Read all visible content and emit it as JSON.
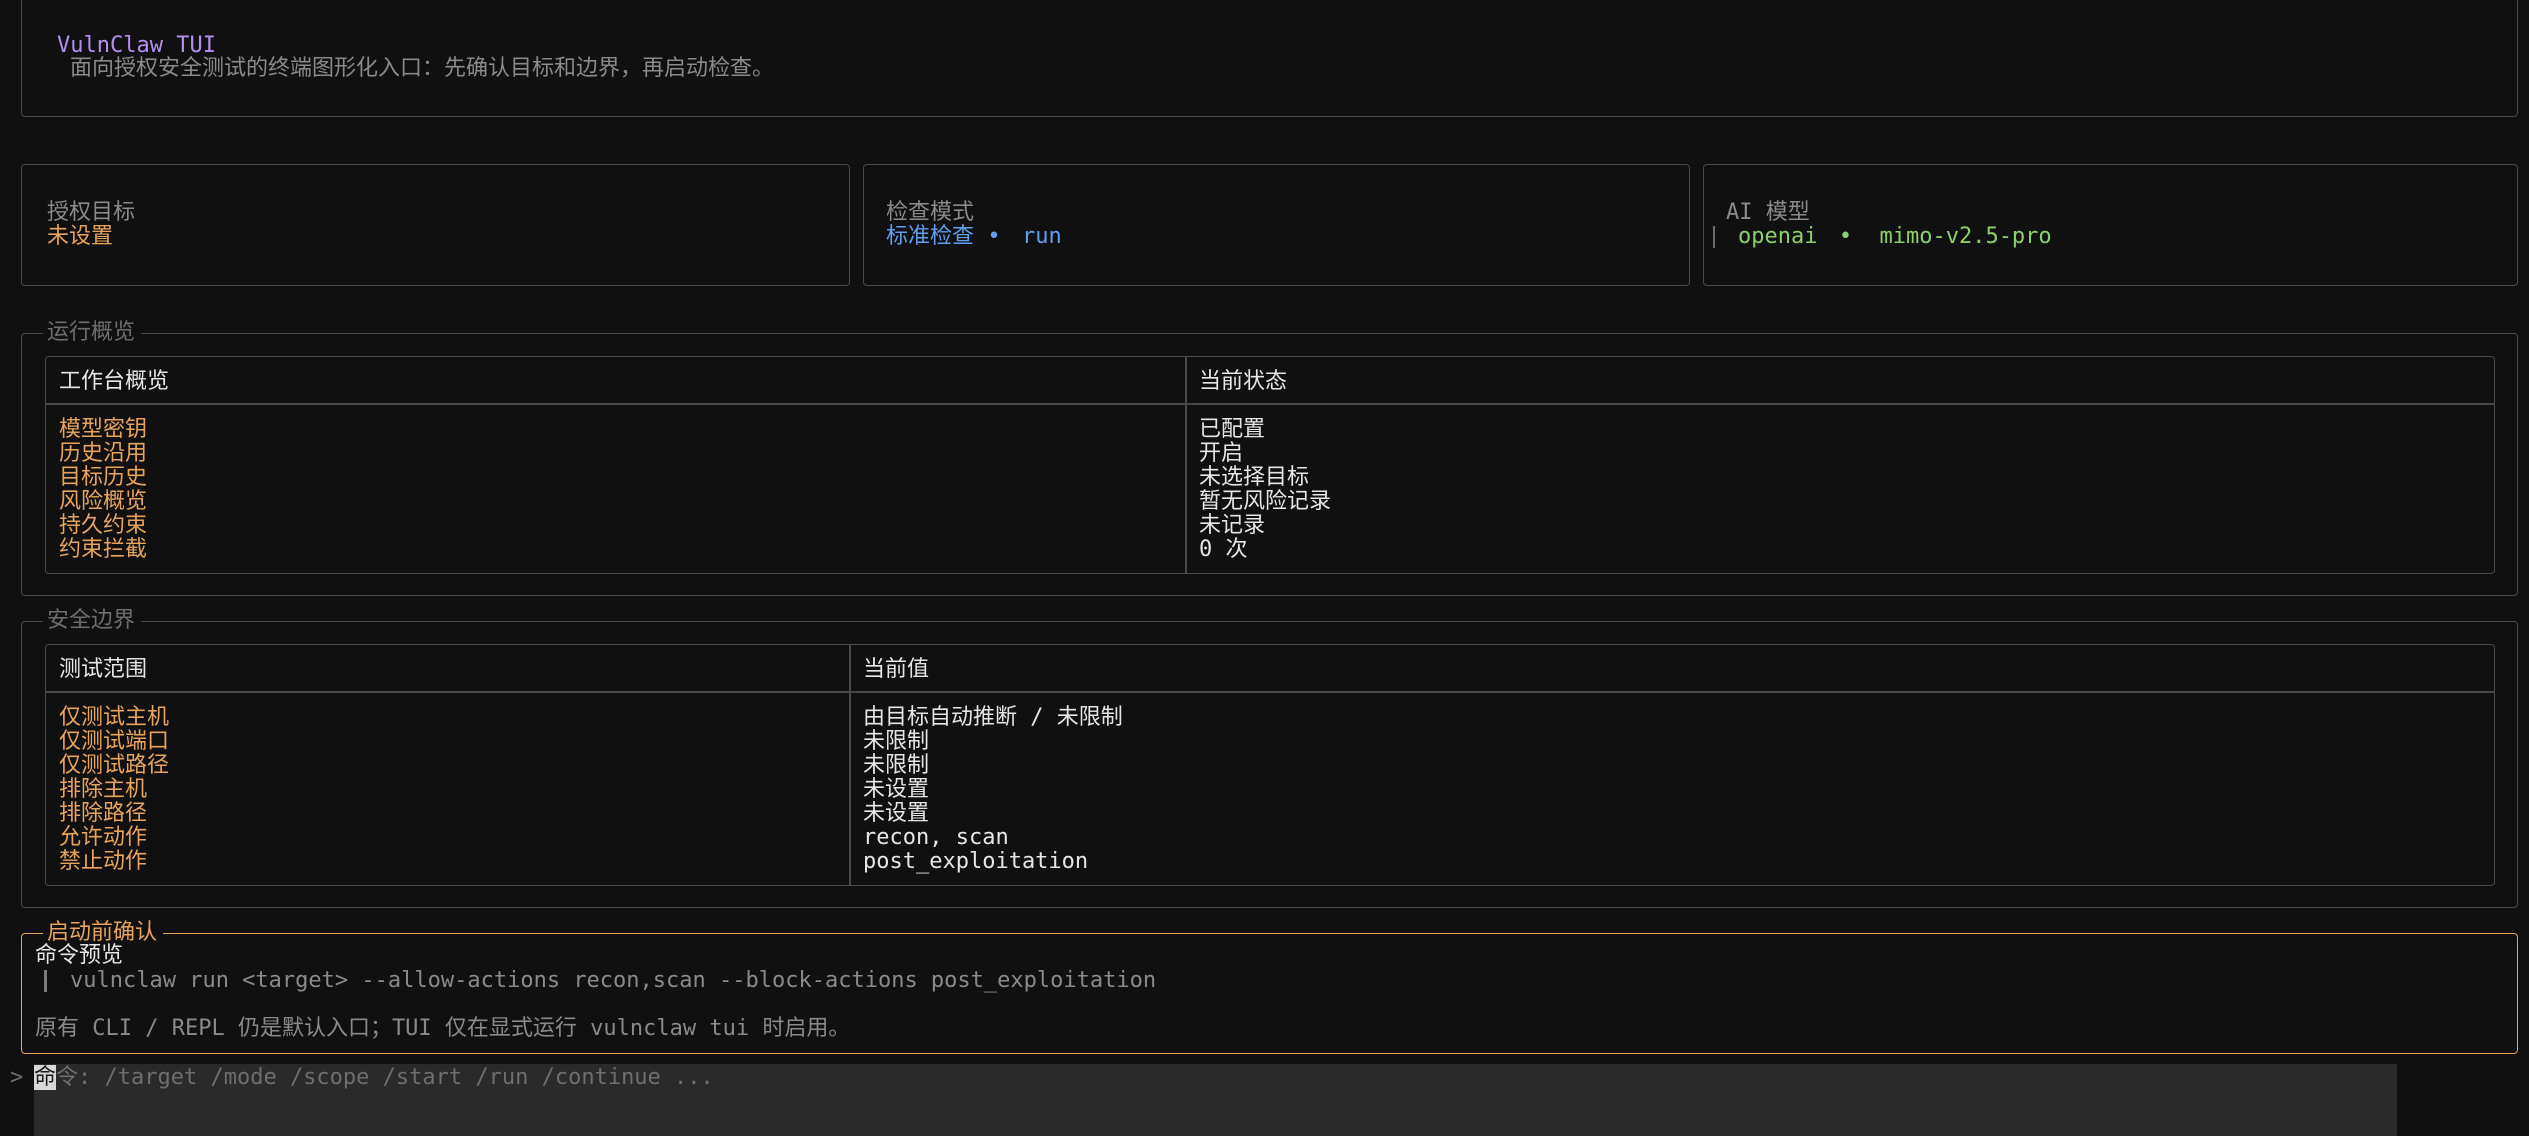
{
  "header": {
    "app_title": "VulnClaw TUI",
    "subtitle": "面向授权安全测试的终端图形化入口：先确认目标和边界，再启动检查。"
  },
  "cards": {
    "target": {
      "label": "授权目标",
      "value": "未设置"
    },
    "mode": {
      "label": "检查模式",
      "value": "标准检查",
      "sep": "•",
      "sub": "run"
    },
    "model": {
      "label": "AI 模型",
      "provider": "openai",
      "sep": "•",
      "name": "mimo-v2.5-pro"
    }
  },
  "overview": {
    "title": "运行概览",
    "col1": "工作台概览",
    "col2": "当前状态",
    "rows": [
      {
        "key": "模型密钥",
        "value": "已配置"
      },
      {
        "key": "历史沿用",
        "value": "开启"
      },
      {
        "key": "目标历史",
        "value": "未选择目标"
      },
      {
        "key": "风险概览",
        "value": "暂无风险记录"
      },
      {
        "key": "持久约束",
        "value": "未记录"
      },
      {
        "key": "约束拦截",
        "value": "0 次"
      }
    ]
  },
  "boundary": {
    "title": "安全边界",
    "col1": "测试范围",
    "col2": "当前值",
    "rows": [
      {
        "key": "仅测试主机",
        "value": "由目标自动推断 / 未限制"
      },
      {
        "key": "仅测试端口",
        "value": "未限制"
      },
      {
        "key": "仅测试路径",
        "value": "未限制"
      },
      {
        "key": "排除主机",
        "value": "未设置"
      },
      {
        "key": "排除路径",
        "value": "未设置"
      },
      {
        "key": "允许动作",
        "value": "recon, scan"
      },
      {
        "key": "禁止动作",
        "value": "post_exploitation"
      }
    ]
  },
  "confirm": {
    "title": "启动前确认",
    "preview_label": "命令预览",
    "command": "vulnclaw run <target> --allow-actions recon,scan --block-actions post_exploitation",
    "note": "原有 CLI / REPL 仍是默认入口；TUI 仅在显式运行 vulnclaw tui 时启用。"
  },
  "prompt": {
    "arrow": ">",
    "cursor_char": "命",
    "placeholder_rest": "令: /target /mode /scope /start /run /continue ..."
  },
  "colors": {
    "background": "#101010",
    "border": "#4a4a4a",
    "accent": "#e3a35a",
    "title": "#b48ef0",
    "mode": "#5e9ff0",
    "model": "#8bd16a"
  }
}
